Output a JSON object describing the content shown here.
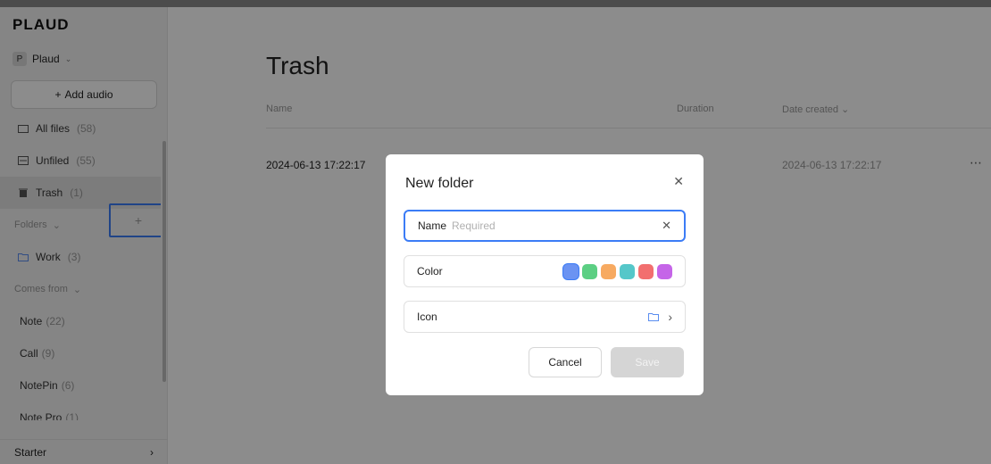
{
  "app": {
    "logo": "PLAUD"
  },
  "sidebar": {
    "workspace": {
      "badge": "P",
      "name": "Plaud"
    },
    "add_audio_label": "Add audio",
    "items": [
      {
        "label": "All files",
        "count": "(58)"
      },
      {
        "label": "Unfiled",
        "count": "(55)"
      },
      {
        "label": "Trash",
        "count": "(1)"
      }
    ],
    "folders_label": "Folders",
    "folders": [
      {
        "label": "Work",
        "count": "(3)"
      }
    ],
    "comes_from_label": "Comes from",
    "sources": [
      {
        "label": "Note",
        "count": "(22)"
      },
      {
        "label": "Call",
        "count": "(9)"
      },
      {
        "label": "NotePin",
        "count": "(6)"
      },
      {
        "label": "Note Pro",
        "count": "(1)"
      }
    ],
    "starter_label": "Starter"
  },
  "main": {
    "title": "Trash",
    "columns": {
      "name": "Name",
      "duration": "Duration",
      "date_created": "Date created"
    },
    "rows": [
      {
        "name": "2024-06-13 17:22:17",
        "date_created": "2024-06-13 17:22:17"
      }
    ]
  },
  "modal": {
    "title": "New folder",
    "name_label": "Name",
    "name_placeholder": "Required",
    "name_value": "",
    "color_label": "Color",
    "colors": [
      "#6b93f2",
      "#5ccf83",
      "#f7aa61",
      "#55c7c9",
      "#f26f6f",
      "#c565e8"
    ],
    "selected_color_index": 0,
    "icon_label": "Icon",
    "icon_value": "folder-icon",
    "cancel_label": "Cancel",
    "save_label": "Save"
  }
}
